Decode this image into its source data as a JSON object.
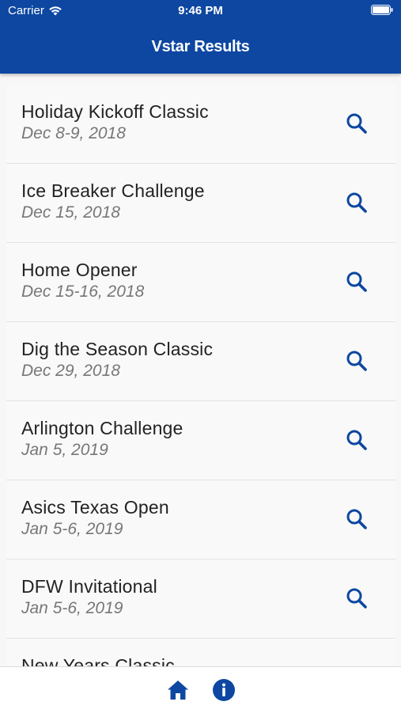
{
  "status": {
    "carrier": "Carrier",
    "time": "9:46 PM"
  },
  "header": {
    "title": "Vstar Results"
  },
  "events": [
    {
      "name": "Holiday Kickoff Classic",
      "date": "Dec 8-9, 2018"
    },
    {
      "name": "Ice Breaker Challenge",
      "date": "Dec 15, 2018"
    },
    {
      "name": "Home Opener",
      "date": "Dec 15-16, 2018"
    },
    {
      "name": "Dig the Season Classic",
      "date": "Dec 29, 2018"
    },
    {
      "name": "Arlington Challenge",
      "date": "Jan 5, 2019"
    },
    {
      "name": "Asics Texas Open",
      "date": "Jan 5-6, 2019"
    },
    {
      "name": "DFW Invitational",
      "date": "Jan 5-6, 2019"
    },
    {
      "name": "New Years Classic",
      "date": ""
    }
  ],
  "row_icon": "search-icon",
  "tab_bar": {
    "items": [
      {
        "icon": "home-icon"
      },
      {
        "icon": "info-icon"
      }
    ]
  },
  "colors": {
    "brand_blue": "#0d47a1",
    "icon_blue": "#0d47a1",
    "date_gray": "#777777"
  }
}
